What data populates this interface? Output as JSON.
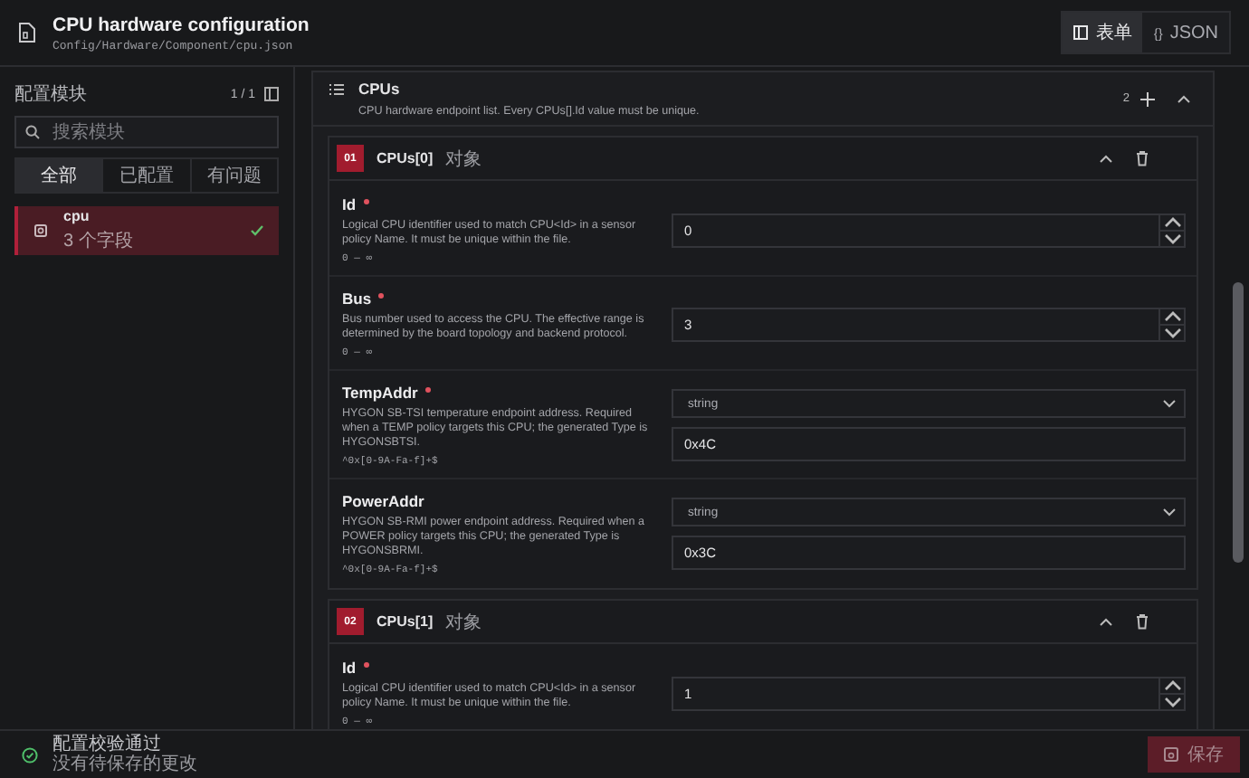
{
  "header": {
    "title": "CPU hardware configuration",
    "path": "Config/Hardware/Component/cpu.json",
    "views": [
      {
        "kind": "form",
        "label": "表单",
        "selected": true
      },
      {
        "kind": "json",
        "icon": "{}",
        "label": "JSON",
        "selected": false
      }
    ]
  },
  "sidebar": {
    "title": "配置模块",
    "count": "1 / 1",
    "search": {
      "placeholder": "搜索模块"
    },
    "filters": [
      {
        "label": "全部",
        "selected": true
      },
      {
        "label": "已配置",
        "selected": false
      },
      {
        "label": "有问题",
        "selected": false
      }
    ],
    "modules": [
      {
        "name": "cpu",
        "subtitle": "3 个字段",
        "selected": true,
        "valid": true
      }
    ]
  },
  "section": {
    "title": "CPUs",
    "description": "CPU hardware endpoint list. Every CPUs[].Id value must be unique.",
    "count": "2",
    "expanded": true,
    "items": [
      {
        "index": "01",
        "title": "CPUs[0]",
        "type": "对象",
        "expanded": true,
        "fields": [
          {
            "kind": "number",
            "name": "Id",
            "required": true,
            "description": "Logical CPU identifier used to match CPU<Id> in a sensor policy Name. It must be unique within the file.",
            "hint": "0 — ∞",
            "value": "0"
          },
          {
            "kind": "number",
            "name": "Bus",
            "required": true,
            "description": "Bus number used to access the CPU. The effective range is determined by the board topology and backend protocol.",
            "hint": "0 — ∞",
            "value": "3"
          },
          {
            "kind": "typed",
            "name": "TempAddr",
            "required": true,
            "description": "HYGON SB-TSI temperature endpoint address. Required when a TEMP policy targets this CPU; the generated Type is HYGONSBTSI.",
            "hint": "^0x[0-9A-Fa-f]+$",
            "type": "string",
            "value": "0x4C"
          },
          {
            "kind": "typed",
            "name": "PowerAddr",
            "required": false,
            "description": "HYGON SB-RMI power endpoint address. Required when a POWER policy targets this CPU; the generated Type is HYGONSBRMI.",
            "hint": "^0x[0-9A-Fa-f]+$",
            "type": "string",
            "value": "0x3C"
          }
        ]
      },
      {
        "index": "02",
        "title": "CPUs[1]",
        "type": "对象",
        "expanded": true,
        "fields": [
          {
            "kind": "number",
            "name": "Id",
            "required": true,
            "description": "Logical CPU identifier used to match CPU<Id> in a sensor policy Name. It must be unique within the file.",
            "hint": "0 — ∞",
            "value": "1"
          }
        ]
      }
    ]
  },
  "footer": {
    "status": {
      "ok": true,
      "title": "配置校验通过",
      "subtitle": "没有待保存的更改"
    },
    "save": {
      "label": "保存",
      "disabled": true
    }
  }
}
